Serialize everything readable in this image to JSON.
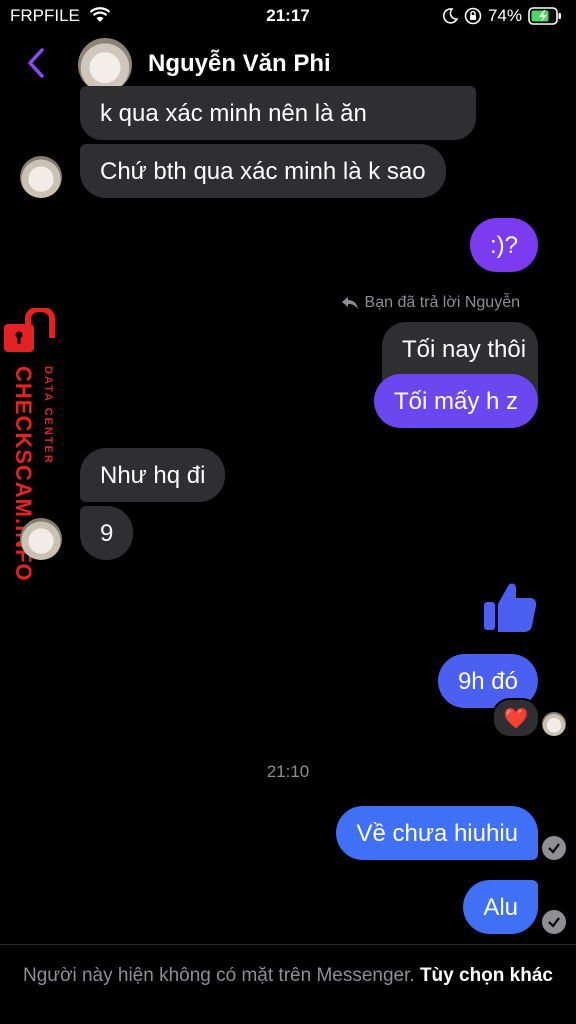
{
  "status_bar": {
    "carrier": "FRPFILE",
    "time": "21:17",
    "battery": "74%"
  },
  "header": {
    "contact_name": "Nguyễn Văn Phi"
  },
  "messages": {
    "m1": "k qua xác minh nên là ăn",
    "m2": "Chứ bth qua xác minh là k sao",
    "m3": ":)?",
    "reply_info": "Bạn đã trả lời Nguyễn",
    "m4_quoted": "Tối nay thôi",
    "m5": "Tối mấy h z",
    "m6": "Như hq đi",
    "m7": "9",
    "m9": "9h đó",
    "reaction": "❤️",
    "timestamp": "21:10",
    "m10": "Về chưa hiuhiu",
    "m11": "Alu"
  },
  "footer": {
    "notice": "Người này hiện không có mặt trên Messenger.",
    "action": "Tùy chọn khác"
  },
  "watermark": {
    "main": "CHECKSCAM.INFO",
    "sub": "DATA CENTER"
  },
  "colors": {
    "accent": "#8a4bff",
    "received_bubble": "#2f2f31",
    "watermark": "#e52222"
  }
}
